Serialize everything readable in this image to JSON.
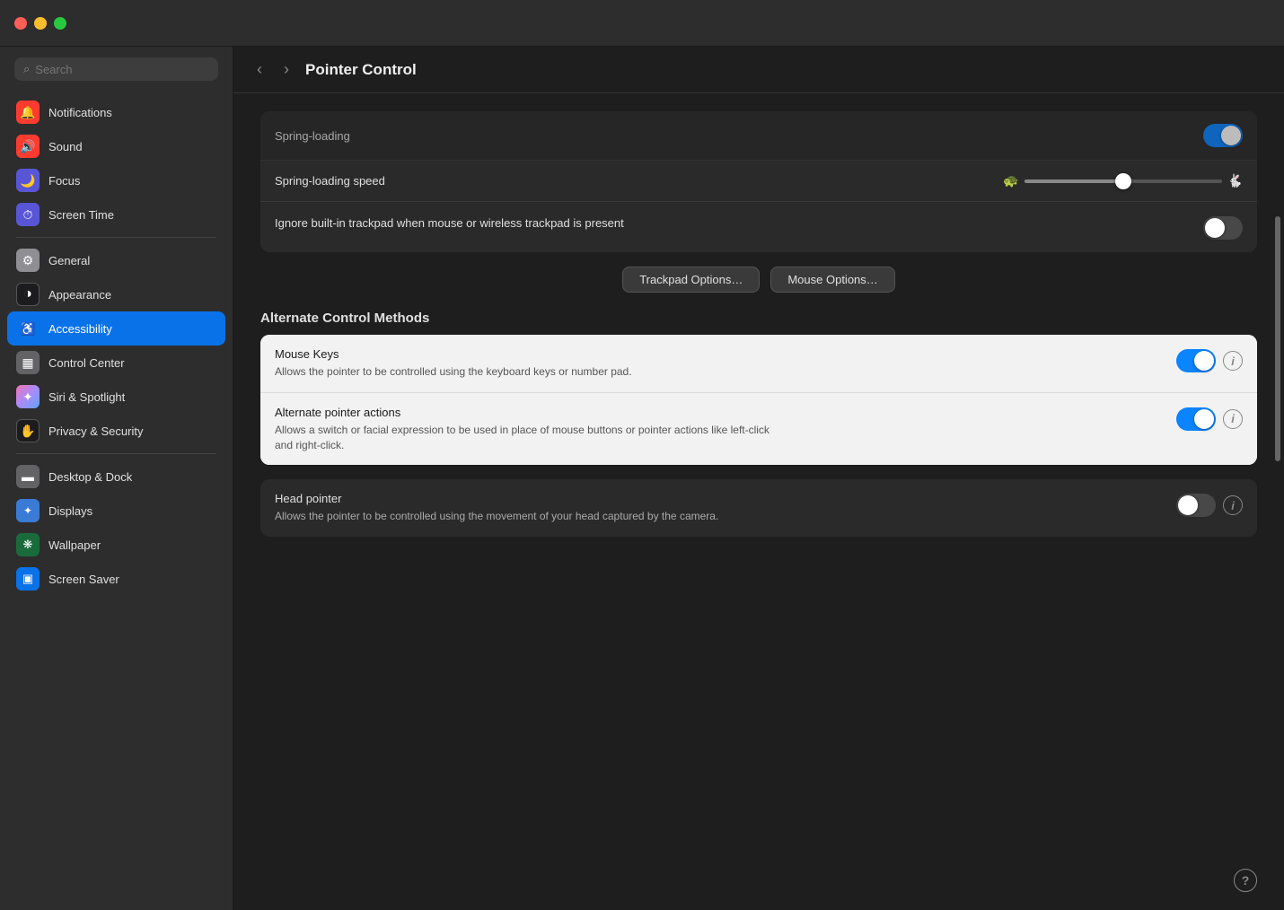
{
  "window": {
    "title": "Pointer Control",
    "traffic_close": "close",
    "traffic_minimize": "minimize",
    "traffic_maximize": "maximize"
  },
  "search": {
    "placeholder": "Search"
  },
  "nav": {
    "back_label": "‹",
    "forward_label": "›"
  },
  "sidebar": {
    "items": [
      {
        "id": "notifications",
        "label": "Notifications",
        "icon": "🔔",
        "icon_class": "icon-notifications"
      },
      {
        "id": "sound",
        "label": "Sound",
        "icon": "🔊",
        "icon_class": "icon-sound"
      },
      {
        "id": "focus",
        "label": "Focus",
        "icon": "🌙",
        "icon_class": "icon-focus"
      },
      {
        "id": "screentime",
        "label": "Screen Time",
        "icon": "⏱",
        "icon_class": "icon-screentime"
      },
      {
        "id": "general",
        "label": "General",
        "icon": "⚙",
        "icon_class": "icon-general"
      },
      {
        "id": "appearance",
        "label": "Appearance",
        "icon": "◑",
        "icon_class": "icon-appearance"
      },
      {
        "id": "accessibility",
        "label": "Accessibility",
        "icon": "♿",
        "icon_class": "icon-accessibility",
        "active": true
      },
      {
        "id": "controlcenter",
        "label": "Control Center",
        "icon": "▦",
        "icon_class": "icon-controlcenter"
      },
      {
        "id": "siri",
        "label": "Siri & Spotlight",
        "icon": "✦",
        "icon_class": "icon-siri"
      },
      {
        "id": "privacy",
        "label": "Privacy & Security",
        "icon": "✋",
        "icon_class": "icon-privacy"
      },
      {
        "id": "desktop",
        "label": "Desktop & Dock",
        "icon": "▬",
        "icon_class": "icon-desktop"
      },
      {
        "id": "displays",
        "label": "Displays",
        "icon": "✦",
        "icon_class": "icon-displays"
      },
      {
        "id": "wallpaper",
        "label": "Wallpaper",
        "icon": "❋",
        "icon_class": "icon-wallpaper"
      },
      {
        "id": "screensaver",
        "label": "Screen Saver",
        "icon": "▣",
        "icon_class": "icon-screensaver"
      }
    ]
  },
  "content": {
    "title": "Pointer Control",
    "spring_loading_label": "Spring-loading",
    "spring_loading_speed_label": "Spring-loading speed",
    "ignore_trackpad_label": "Ignore built-in trackpad when mouse or wireless trackpad is present",
    "trackpad_options_btn": "Trackpad Options…",
    "mouse_options_btn": "Mouse Options…",
    "alternate_control_methods_header": "Alternate Control Methods",
    "mouse_keys_label": "Mouse Keys",
    "mouse_keys_desc": "Allows the pointer to be controlled using the keyboard keys or number pad.",
    "mouse_keys_enabled": true,
    "alt_pointer_label": "Alternate pointer actions",
    "alt_pointer_desc": "Allows a switch or facial expression to be used in place of mouse buttons or pointer actions like left-click and right-click.",
    "alt_pointer_enabled": true,
    "head_pointer_label": "Head pointer",
    "head_pointer_desc": "Allows the pointer to be controlled using the movement of your head captured by the camera.",
    "head_pointer_enabled": false
  }
}
